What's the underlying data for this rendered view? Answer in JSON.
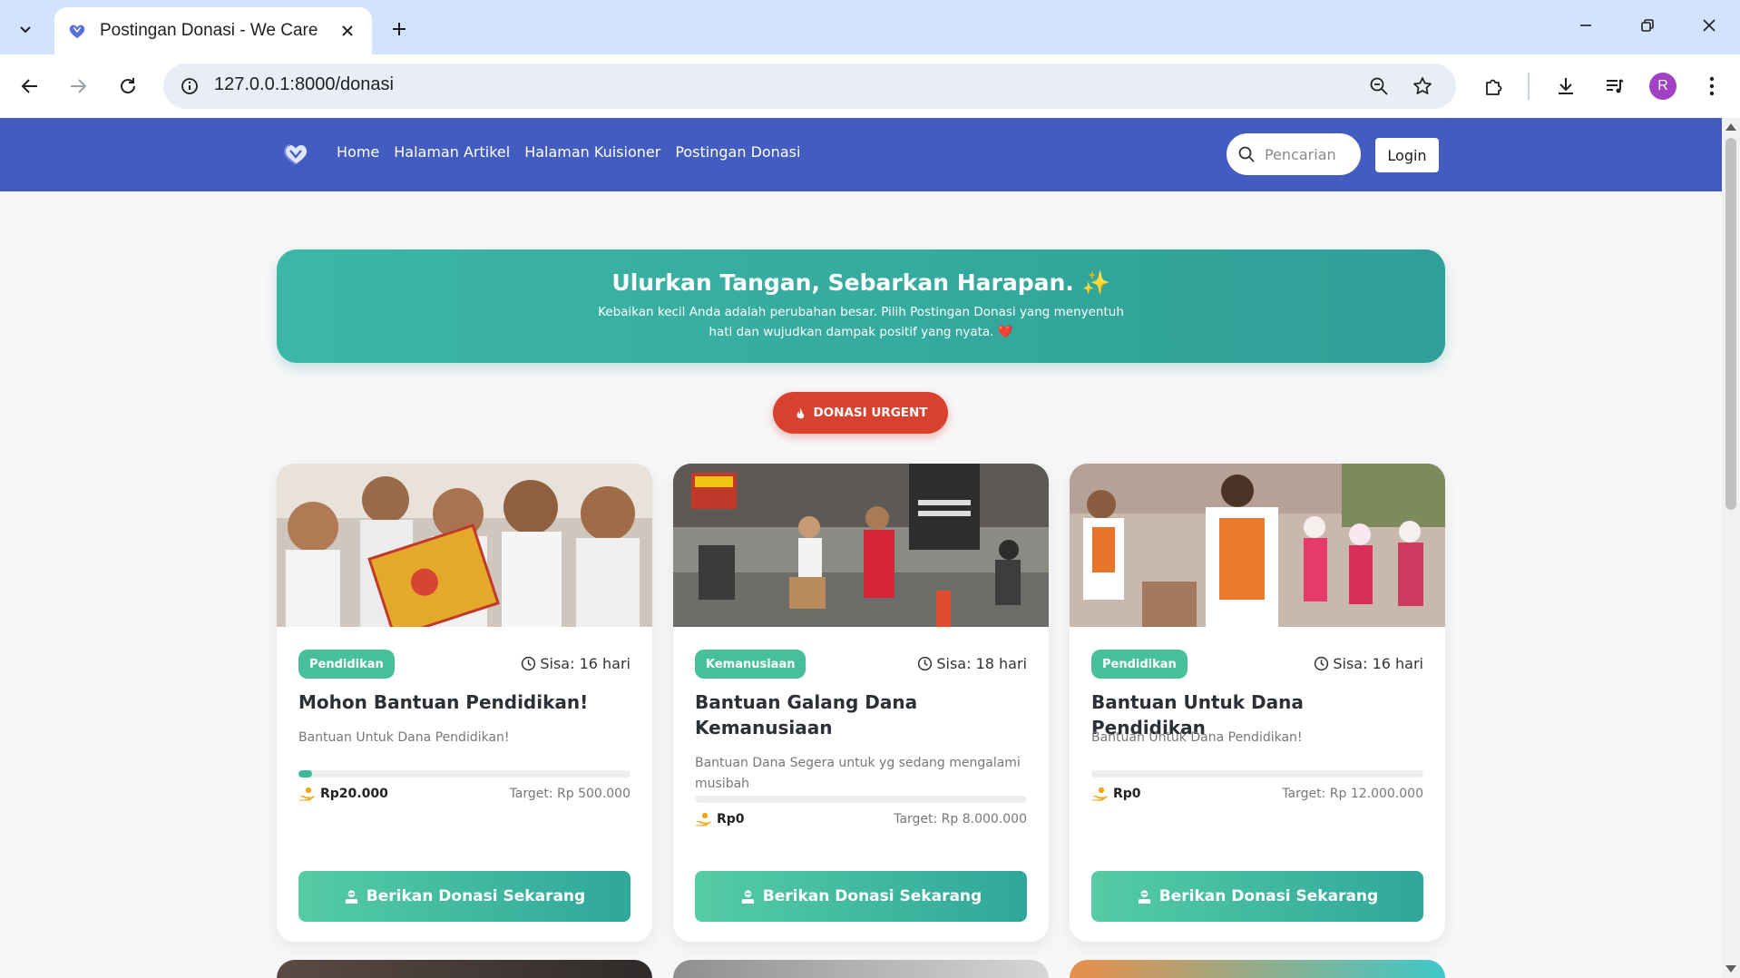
{
  "browser": {
    "tab_title": "Postingan Donasi - We Care",
    "url": "127.0.0.1:8000/donasi",
    "profile_initial": "R"
  },
  "navbar": {
    "links": [
      "Home",
      "Halaman Artikel",
      "Halaman Kuisioner",
      "Postingan Donasi"
    ],
    "search_placeholder": "Pencarian",
    "login_label": "Login",
    "bg_color": "#435cbf"
  },
  "hero": {
    "title": "Ulurkan Tangan, Sebarkan Harapan. ✨",
    "subtitle_line1": "Kebaikan kecil Anda adalah perubahan besar. Pilih Postingan Donasi yang menyentuh",
    "subtitle_line2": "hati dan wujudkan dampak positif yang nyata. ❤️"
  },
  "urgent_button": {
    "label": "DONASI URGENT",
    "icon": "fire-icon"
  },
  "cards": [
    {
      "category": "Pendidikan",
      "remaining": "Sisa: 16 hari",
      "title": "Mohon Bantuan Pendidikan!",
      "description": "Bantuan Untuk Dana Pendidikan!",
      "collected": "Rp20.000",
      "target": "Target: Rp 500.000",
      "progress_fraction": 0.04,
      "button_label": "Berikan Donasi Sekarang"
    },
    {
      "category": "Kemanusiaan",
      "remaining": "Sisa: 18 hari",
      "title": "Bantuan Galang Dana Kemanusiaan",
      "description": "Bantuan Dana Segera untuk yg sedang mengalami musibah",
      "collected": "Rp0",
      "target": "Target: Rp 8.000.000",
      "progress_fraction": 0,
      "button_label": "Berikan Donasi Sekarang"
    },
    {
      "category": "Pendidikan",
      "remaining": "Sisa: 16 hari",
      "title": "Bantuan Untuk Dana Pendidikan",
      "description": "Bantuan Untuk Dana Pendidikan!",
      "collected": "Rp0",
      "target": "Target: Rp 12.000.000",
      "progress_fraction": 0,
      "button_label": "Berikan Donasi Sekarang"
    }
  ],
  "colors": {
    "accent": "#3fb79b",
    "urgent": "#d9412f",
    "hero": "#2f9f97"
  }
}
